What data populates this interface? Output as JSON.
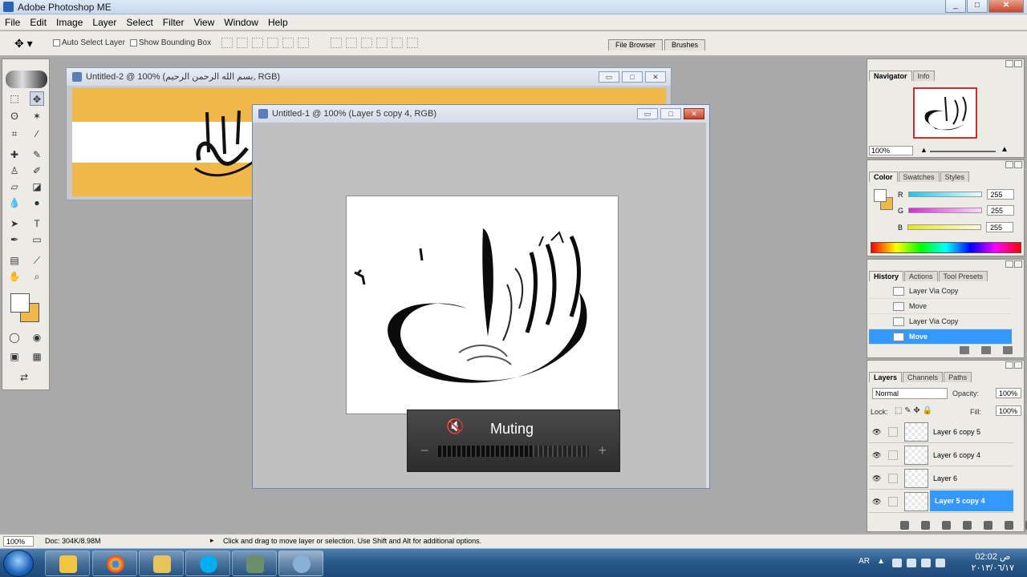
{
  "window": {
    "title": "Adobe Photoshop ME",
    "minimize": "_",
    "maximize": "□",
    "close": "✕"
  },
  "menu": [
    "File",
    "Edit",
    "Image",
    "Layer",
    "Select",
    "Filter",
    "View",
    "Window",
    "Help"
  ],
  "options": {
    "tool_icon": "move-tool-icon",
    "auto_select": "Auto Select Layer",
    "show_bounding": "Show Bounding Box",
    "well_tabs": [
      "File Browser",
      "Brushes"
    ]
  },
  "doc2": {
    "title": "Untitled-2 @ 100% (بسم الله الرحمن الرحيم, RGB)"
  },
  "doc1": {
    "title": "Untitled-1 @ 100% (Layer 5 copy 4, RGB)"
  },
  "osd": {
    "label": "Muting",
    "minus": "−",
    "plus": "+",
    "icon": "speaker-muted-icon",
    "level": 0.62
  },
  "navigator": {
    "tabs": [
      "Navigator",
      "Info"
    ],
    "zoom": "100%"
  },
  "color": {
    "tabs": [
      "Color",
      "Swatches",
      "Styles"
    ],
    "rows": [
      {
        "label": "R",
        "value": "255",
        "color": "#19c8e6"
      },
      {
        "label": "G",
        "value": "255",
        "color": "#d82ad8"
      },
      {
        "label": "B",
        "value": "255",
        "color": "#e6e619"
      }
    ],
    "foreground": "#ffffff",
    "background": "#f0b849"
  },
  "history": {
    "tabs": [
      "History",
      "Actions",
      "Tool Presets"
    ],
    "items": [
      "Layer Via Copy",
      "Move",
      "Layer Via Copy",
      "Move"
    ]
  },
  "layers": {
    "tabs": [
      "Layers",
      "Channels",
      "Paths"
    ],
    "blend": "Normal",
    "opacity_label": "Opacity:",
    "opacity": "100%",
    "lock_label": "Lock:",
    "fill_label": "Fill:",
    "fill": "100%",
    "items": [
      "Layer 6 copy 5",
      "Layer 6 copy 4",
      "Layer 6",
      "Layer 5 copy 4"
    ]
  },
  "status": {
    "zoom": "100%",
    "doc": "Doc: 304K/8.98M",
    "hint": "Click and drag to move layer or selection.  Use Shift and Alt for additional options."
  },
  "taskbar": {
    "apps": [
      "windows-explorer-icon",
      "chrome-icon",
      "folder-icon",
      "skype-icon",
      "app-icon",
      "photoshop-icon"
    ],
    "lang": "AR",
    "time": "02:02 ص",
    "date": "٢٠١٣/٠٦/١٧"
  }
}
